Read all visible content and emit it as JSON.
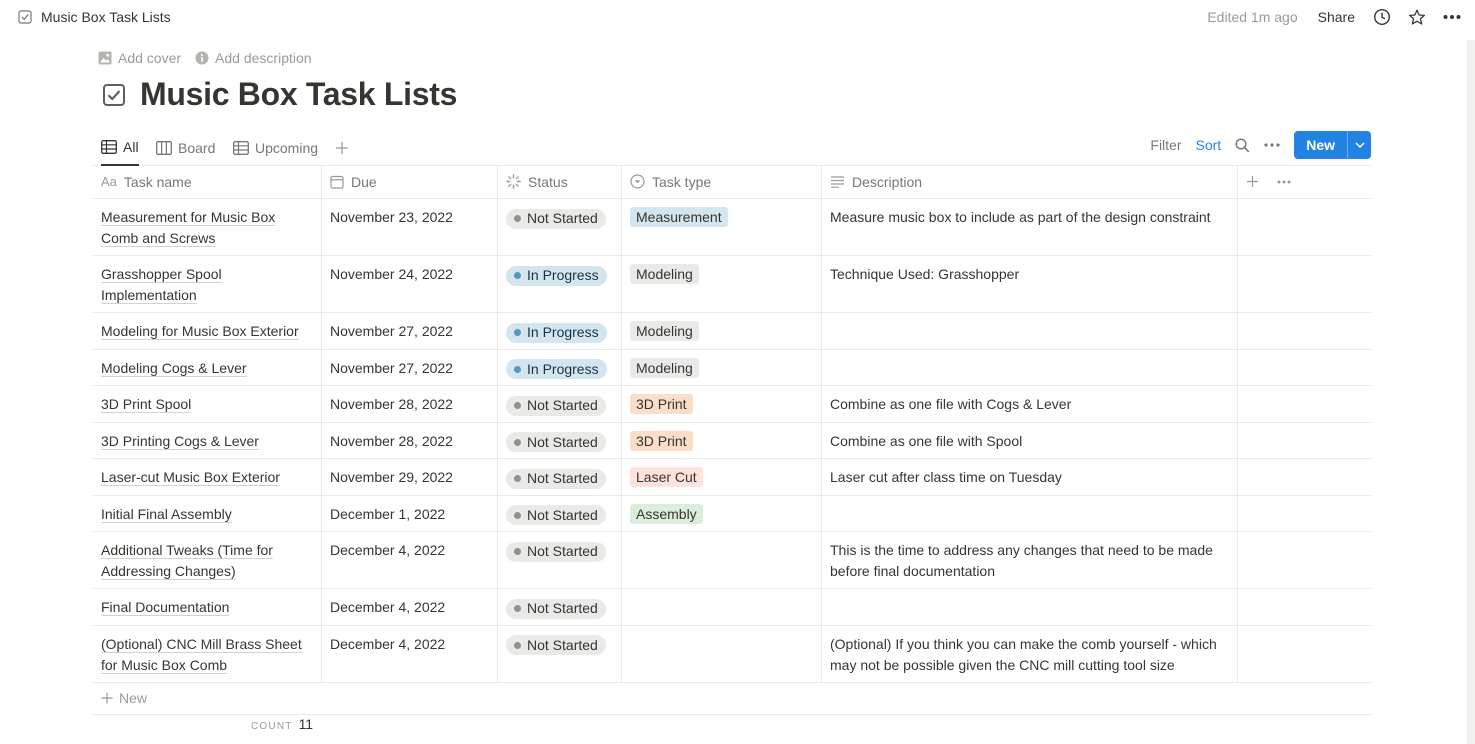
{
  "topbar": {
    "breadcrumb": "Music Box Task Lists",
    "edited": "Edited 1m ago",
    "share": "Share"
  },
  "header": {
    "add_cover": "Add cover",
    "add_description": "Add description",
    "title": "Music Box Task Lists"
  },
  "views": {
    "tabs": [
      {
        "label": "All"
      },
      {
        "label": "Board"
      },
      {
        "label": "Upcoming"
      }
    ],
    "filter": "Filter",
    "sort": "Sort",
    "new": "New"
  },
  "table": {
    "columns": [
      "Task name",
      "Due",
      "Status",
      "Task type",
      "Description"
    ],
    "rows": [
      {
        "name": "Measurement for Music Box Comb and Screws",
        "due": "November 23, 2022",
        "status": "Not Started",
        "type": "Measurement",
        "description": "Measure music box to include as part of the design constraint"
      },
      {
        "name": "Grasshopper Spool Implementation",
        "due": "November 24, 2022",
        "status": "In Progress",
        "type": "Modeling",
        "description": "Technique Used: Grasshopper"
      },
      {
        "name": "Modeling for Music Box Exterior",
        "due": "November 27, 2022",
        "status": "In Progress",
        "type": "Modeling",
        "description": ""
      },
      {
        "name": "Modeling Cogs & Lever",
        "due": "November 27, 2022",
        "status": "In Progress",
        "type": "Modeling",
        "description": ""
      },
      {
        "name": "3D Print Spool",
        "due": "November 28, 2022",
        "status": "Not Started",
        "type": "3D Print",
        "description": "Combine as one file with Cogs & Lever"
      },
      {
        "name": "3D Printing Cogs & Lever",
        "due": "November 28, 2022",
        "status": "Not Started",
        "type": "3D Print",
        "description": "Combine as one file with Spool"
      },
      {
        "name": "Laser-cut Music Box Exterior",
        "due": "November 29, 2022",
        "status": "Not Started",
        "type": "Laser Cut",
        "description": "Laser cut after class time on Tuesday"
      },
      {
        "name": "Initial Final Assembly",
        "due": "December 1, 2022",
        "status": "Not Started",
        "type": "Assembly",
        "description": ""
      },
      {
        "name": "Additional Tweaks (Time for Addressing Changes)",
        "due": "December 4, 2022",
        "status": "Not Started",
        "type": "",
        "description": "This is the time to address any changes that need to be made before final documentation"
      },
      {
        "name": "Final Documentation",
        "due": "December 4, 2022",
        "status": "Not Started",
        "type": "",
        "description": ""
      },
      {
        "name": "(Optional) CNC Mill Brass Sheet for Music Box Comb",
        "due": "December 4, 2022",
        "status": "Not Started",
        "type": "",
        "description": "(Optional) If you think you can make the comb yourself - which may not be possible given the CNC mill cutting tool size"
      }
    ],
    "new_row": "New",
    "count_label": "COUNT",
    "count_value": "11"
  },
  "colors": {
    "accent": "#2383e2",
    "tag_measurement": "#d3e5ef",
    "tag_modeling": "#e9e9e7",
    "tag_3dprint": "#fadec9",
    "tag_lasercut": "#ffe2dd",
    "tag_assembly": "#dbeddb"
  }
}
